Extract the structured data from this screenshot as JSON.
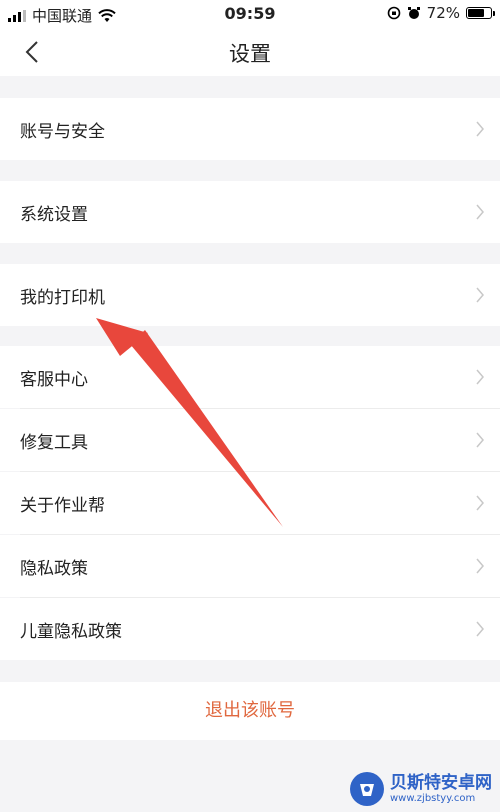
{
  "status_bar": {
    "carrier": "中国联通",
    "time": "09:59",
    "battery": "72%"
  },
  "nav": {
    "title": "设置"
  },
  "menu": {
    "account_security": "账号与安全",
    "system_settings": "系统设置",
    "my_printer": "我的打印机",
    "customer_service": "客服中心",
    "repair_tools": "修复工具",
    "about": "关于作业帮",
    "privacy_policy": "隐私政策",
    "child_privacy_policy": "儿童隐私政策"
  },
  "logout_label": "退出该账号",
  "watermark": {
    "title": "贝斯特安卓网",
    "url": "www.zjbstyy.com"
  },
  "colors": {
    "logout_text": "#e0683f",
    "annotation_arrow": "#e8473c",
    "watermark_blue": "#2f63c7"
  }
}
